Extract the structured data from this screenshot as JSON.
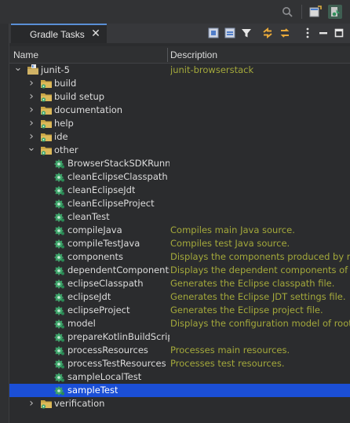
{
  "topbar": {
    "icons": [
      "search-icon",
      "perspective-icon",
      "gradle-perspective-icon"
    ]
  },
  "view": {
    "tab_label": "Gradle Tasks",
    "close_glyph": "✕",
    "toolbar_icons": [
      "refresh-icon",
      "collapse-all-icon",
      "filter-icon",
      "link-icon",
      "sync-icon",
      "view-menu-icon",
      "minimize-icon",
      "maximize-icon"
    ]
  },
  "columns": {
    "name": "Name",
    "description": "Description"
  },
  "tree": {
    "root": {
      "label": "junit-5",
      "description": "junit-browserstack"
    },
    "groups_before": [
      {
        "label": "build"
      },
      {
        "label": "build setup"
      },
      {
        "label": "documentation"
      },
      {
        "label": "help"
      },
      {
        "label": "ide"
      }
    ],
    "other": {
      "label": "other"
    },
    "tasks": [
      {
        "label": "BrowserStackSDKRunne",
        "description": ""
      },
      {
        "label": "cleanEclipseClasspath",
        "description": ""
      },
      {
        "label": "cleanEclipseJdt",
        "description": ""
      },
      {
        "label": "cleanEclipseProject",
        "description": ""
      },
      {
        "label": "cleanTest",
        "description": ""
      },
      {
        "label": "compileJava",
        "description": "Compiles main Java source."
      },
      {
        "label": "compileTestJava",
        "description": "Compiles test Java source."
      },
      {
        "label": "components",
        "description": "Displays the components produced by root"
      },
      {
        "label": "dependentComponents",
        "description": "Displays the dependent components of com"
      },
      {
        "label": "eclipseClasspath",
        "description": "Generates the Eclipse classpath file."
      },
      {
        "label": "eclipseJdt",
        "description": "Generates the Eclipse JDT settings file."
      },
      {
        "label": "eclipseProject",
        "description": "Generates the Eclipse project file."
      },
      {
        "label": "model",
        "description": "Displays the configuration model of root pro"
      },
      {
        "label": "prepareKotlinBuildScript",
        "description": ""
      },
      {
        "label": "processResources",
        "description": "Processes main resources."
      },
      {
        "label": "processTestResources",
        "description": "Processes test resources."
      },
      {
        "label": "sampleLocalTest",
        "description": ""
      },
      {
        "label": "sampleTest",
        "description": ""
      }
    ],
    "selected_task": "sampleTest",
    "groups_after": [
      {
        "label": "verification"
      }
    ]
  },
  "colors": {
    "selection": "#1b4fd6",
    "description_text": "#a4a93b",
    "folder": "#c9a646",
    "task_gear": "#3fa56b"
  }
}
